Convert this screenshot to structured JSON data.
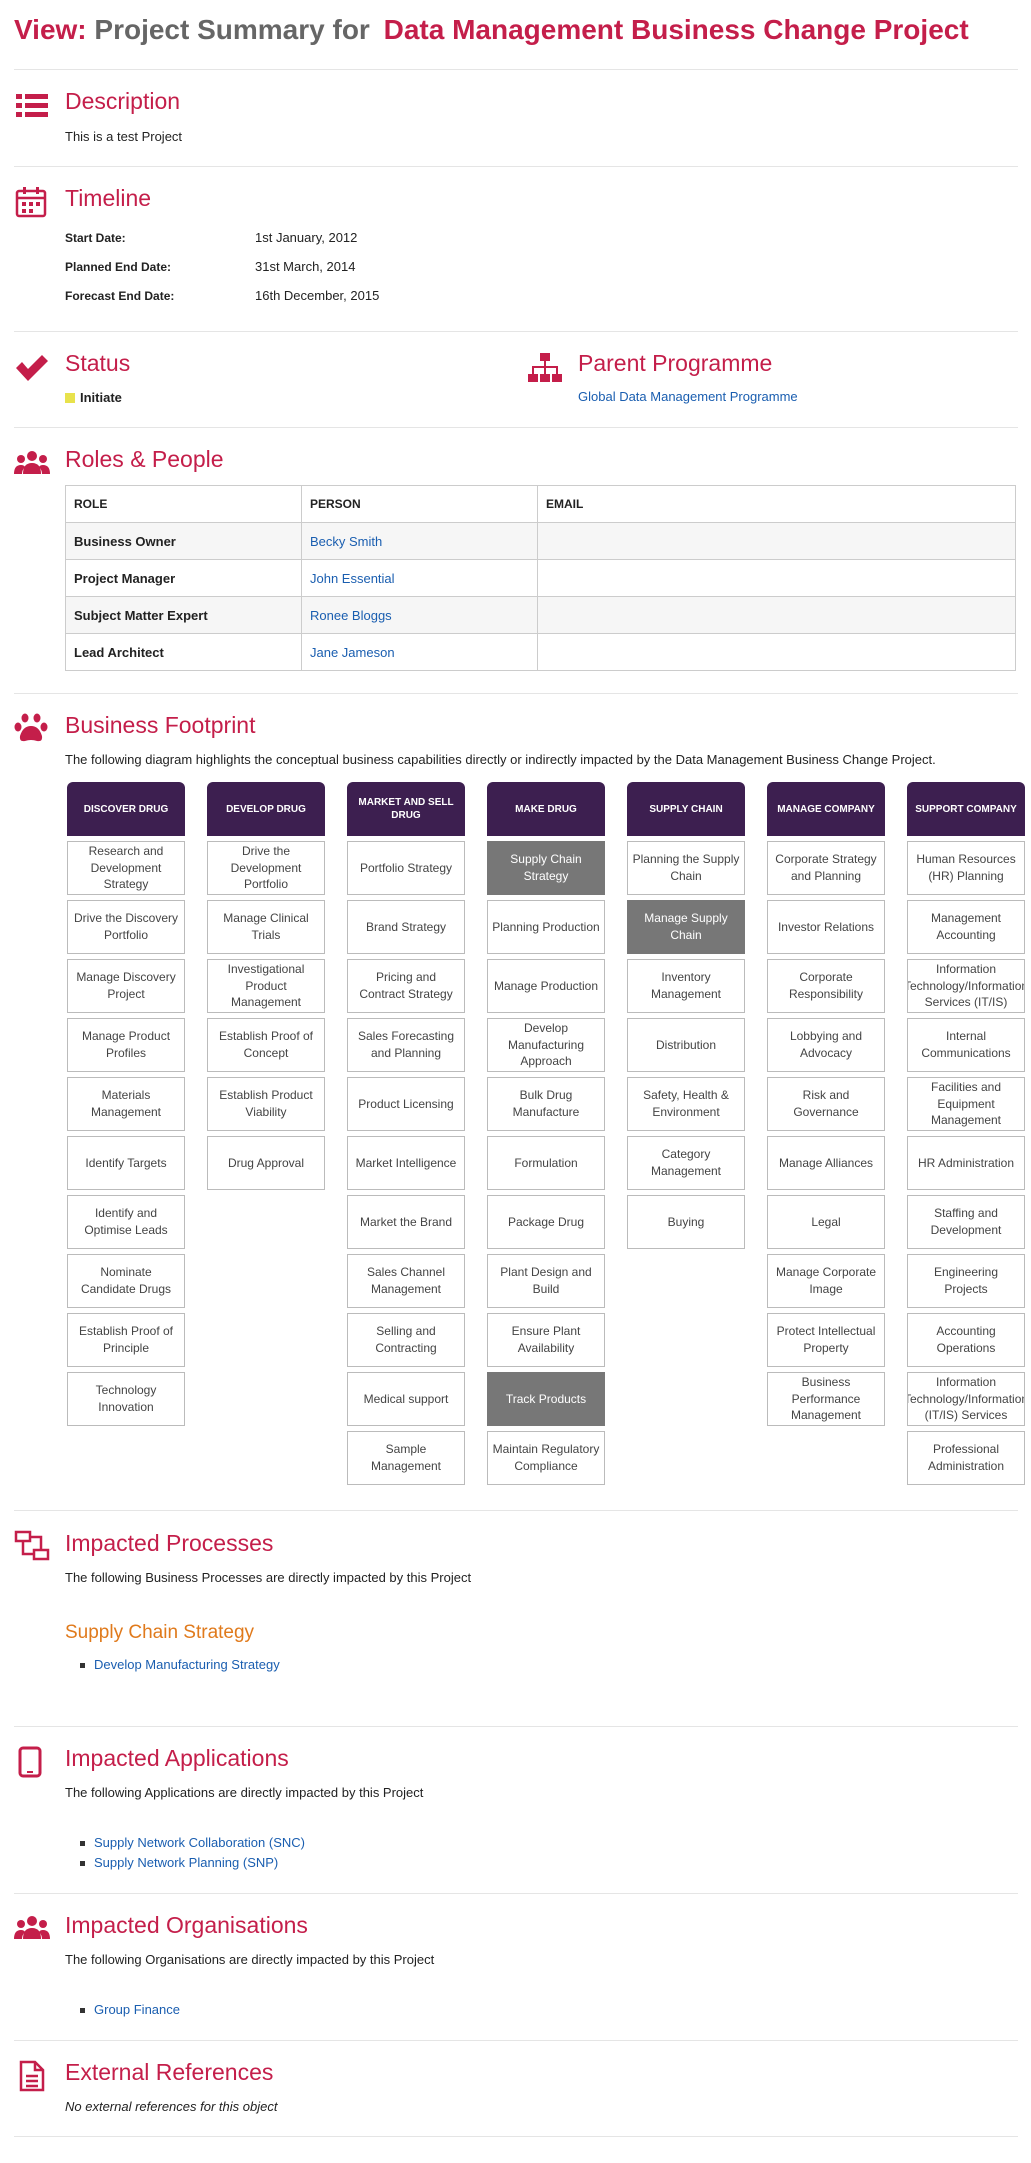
{
  "header": {
    "prefix": "View:",
    "middle": "Project Summary for",
    "project": "Data Management Business Change Project"
  },
  "description": {
    "title": "Description",
    "text": "This is a test Project"
  },
  "timeline": {
    "title": "Timeline",
    "rows": [
      {
        "label": "Start Date:",
        "value": "1st January, 2012"
      },
      {
        "label": "Planned End Date:",
        "value": "31st March, 2014"
      },
      {
        "label": "Forecast End Date:",
        "value": "16th December, 2015"
      }
    ]
  },
  "status": {
    "title": "Status",
    "value": "Initiate",
    "color": "#e8e24c"
  },
  "parent": {
    "title": "Parent Programme",
    "link": "Global Data Management Programme"
  },
  "roles": {
    "title": "Roles & People",
    "headers": [
      "ROLE",
      "PERSON",
      "EMAIL"
    ],
    "rows": [
      {
        "role": "Business Owner",
        "person": "Becky Smith",
        "email": ""
      },
      {
        "role": "Project Manager",
        "person": "John Essential",
        "email": ""
      },
      {
        "role": "Subject Matter Expert",
        "person": "Ronee Bloggs",
        "email": ""
      },
      {
        "role": "Lead Architect",
        "person": "Jane Jameson",
        "email": ""
      }
    ]
  },
  "footprint": {
    "title": "Business Footprint",
    "intro": "The following diagram highlights the conceptual business capabilities directly or indirectly impacted by the  Data Management Business Change Project.",
    "columns": [
      {
        "name": "DISCOVER DRUG",
        "items": [
          "Research and Development Strategy",
          "Drive the Discovery Portfolio",
          "Manage Discovery Project",
          "Manage Product Profiles",
          "Materials Management",
          "Identify Targets",
          "Identify and Optimise Leads",
          "Nominate Candidate Drugs",
          "Establish Proof of Principle",
          "Technology Innovation"
        ]
      },
      {
        "name": "DEVELOP DRUG",
        "items": [
          "Drive the Development Portfolio",
          "Manage Clinical Trials",
          "Investigational Product Management",
          "Establish Proof of Concept",
          "Establish Product Viability",
          "Drug Approval"
        ]
      },
      {
        "name": "MARKET AND SELL DRUG",
        "items": [
          "Portfolio Strategy",
          "Brand Strategy",
          "Pricing and Contract Strategy",
          "Sales Forecasting and Planning",
          "Product Licensing",
          "Market Intelligence",
          "Market the Brand",
          "Sales Channel Management",
          "Selling and Contracting",
          "Medical support",
          "Sample Management"
        ]
      },
      {
        "name": "MAKE DRUG",
        "items": [
          "Supply Chain Strategy",
          "Planning Production",
          "Manage Production",
          "Develop Manufacturing Approach",
          "Bulk Drug Manufacture",
          "Formulation",
          "Package Drug",
          "Plant Design and Build",
          "Ensure Plant Availability",
          "Track Products",
          "Maintain Regulatory Compliance"
        ],
        "highlighted": [
          "Supply Chain Strategy",
          "Track Products"
        ]
      },
      {
        "name": "SUPPLY CHAIN",
        "items": [
          "Planning the Supply Chain",
          "Manage Supply Chain",
          "Inventory Management",
          "Distribution",
          "Safety, Health & Environment",
          "Category Management",
          "Buying"
        ],
        "highlighted": [
          "Manage Supply Chain"
        ]
      },
      {
        "name": "MANAGE COMPANY",
        "items": [
          "Corporate Strategy and Planning",
          "Investor Relations",
          "Corporate Responsibility",
          "Lobbying and Advocacy",
          "Risk and Governance",
          "Manage Alliances",
          "Legal",
          "Manage Corporate Image",
          "Protect Intellectual Property",
          "Business Performance Management"
        ]
      },
      {
        "name": "SUPPORT COMPANY",
        "items": [
          "Human Resources (HR) Planning",
          "Management Accounting",
          "Information Technology/Information Services (IT/IS)",
          "Internal Communications",
          "Facilities and Equipment Management",
          "HR Administration",
          "Staffing and Development",
          "Engineering Projects",
          "Accounting Operations",
          "Information Technology/Information (IT/IS) Services",
          "Professional Administration"
        ]
      }
    ]
  },
  "processes": {
    "title": "Impacted Processes",
    "intro": "The following Business Processes are directly impacted by this Project",
    "group": "Supply Chain Strategy",
    "items": [
      "Develop Manufacturing Strategy"
    ]
  },
  "applications": {
    "title": "Impacted Applications",
    "intro": "The following Applications are directly impacted by this Project",
    "items": [
      "Supply Network Collaboration (SNC)",
      "Supply Network Planning (SNP)"
    ]
  },
  "organisations": {
    "title": "Impacted Organisations",
    "intro": "The following Organisations are directly impacted by this Project",
    "items": [
      "Group Finance"
    ]
  },
  "references": {
    "title": "External References",
    "text": "No external references for this object"
  }
}
